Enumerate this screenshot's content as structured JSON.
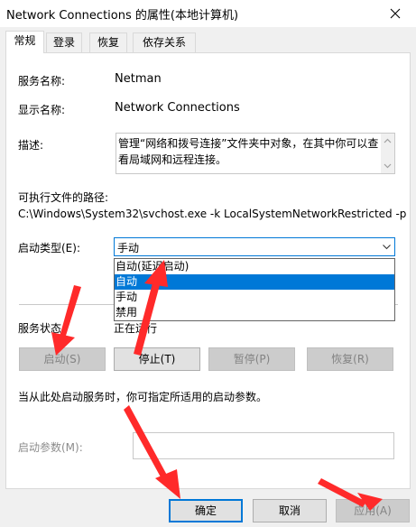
{
  "window": {
    "title": "Network Connections 的属性(本地计算机)"
  },
  "tabs": [
    {
      "label": "常规"
    },
    {
      "label": "登录"
    },
    {
      "label": "恢复"
    },
    {
      "label": "依存关系"
    }
  ],
  "general": {
    "service_name_label": "服务名称:",
    "service_name_value": "Netman",
    "display_name_label": "显示名称:",
    "display_name_value": "Network Connections",
    "description_label": "描述:",
    "description_value": "管理“网络和拨号连接”文件夹中对象，在其中你可以查看局域网和远程连接。",
    "exe_path_label": "可执行文件的路径:",
    "exe_path_value": "C:\\Windows\\System32\\svchost.exe -k LocalSystemNetworkRestricted -p",
    "startup_type_label": "启动类型(E):",
    "startup_type_value": "手动",
    "startup_options": [
      "自动(延迟启动)",
      "自动",
      "手动",
      "禁用"
    ],
    "service_status_label": "服务状态:",
    "service_status_value": "正在运行",
    "start_button": "启动(S)",
    "stop_button": "停止(T)",
    "pause_button": "暂停(P)",
    "resume_button": "恢复(R)",
    "hint_text": "当从此处启动服务时，你可指定所适用的启动参数。",
    "start_params_label": "启动参数(M):",
    "start_params_value": ""
  },
  "footer": {
    "ok_button": "确定",
    "cancel_button": "取消",
    "apply_button": "应用(A)"
  },
  "colors": {
    "accent": "#0078d7",
    "annotation_arrow": "#ff2a2a"
  }
}
